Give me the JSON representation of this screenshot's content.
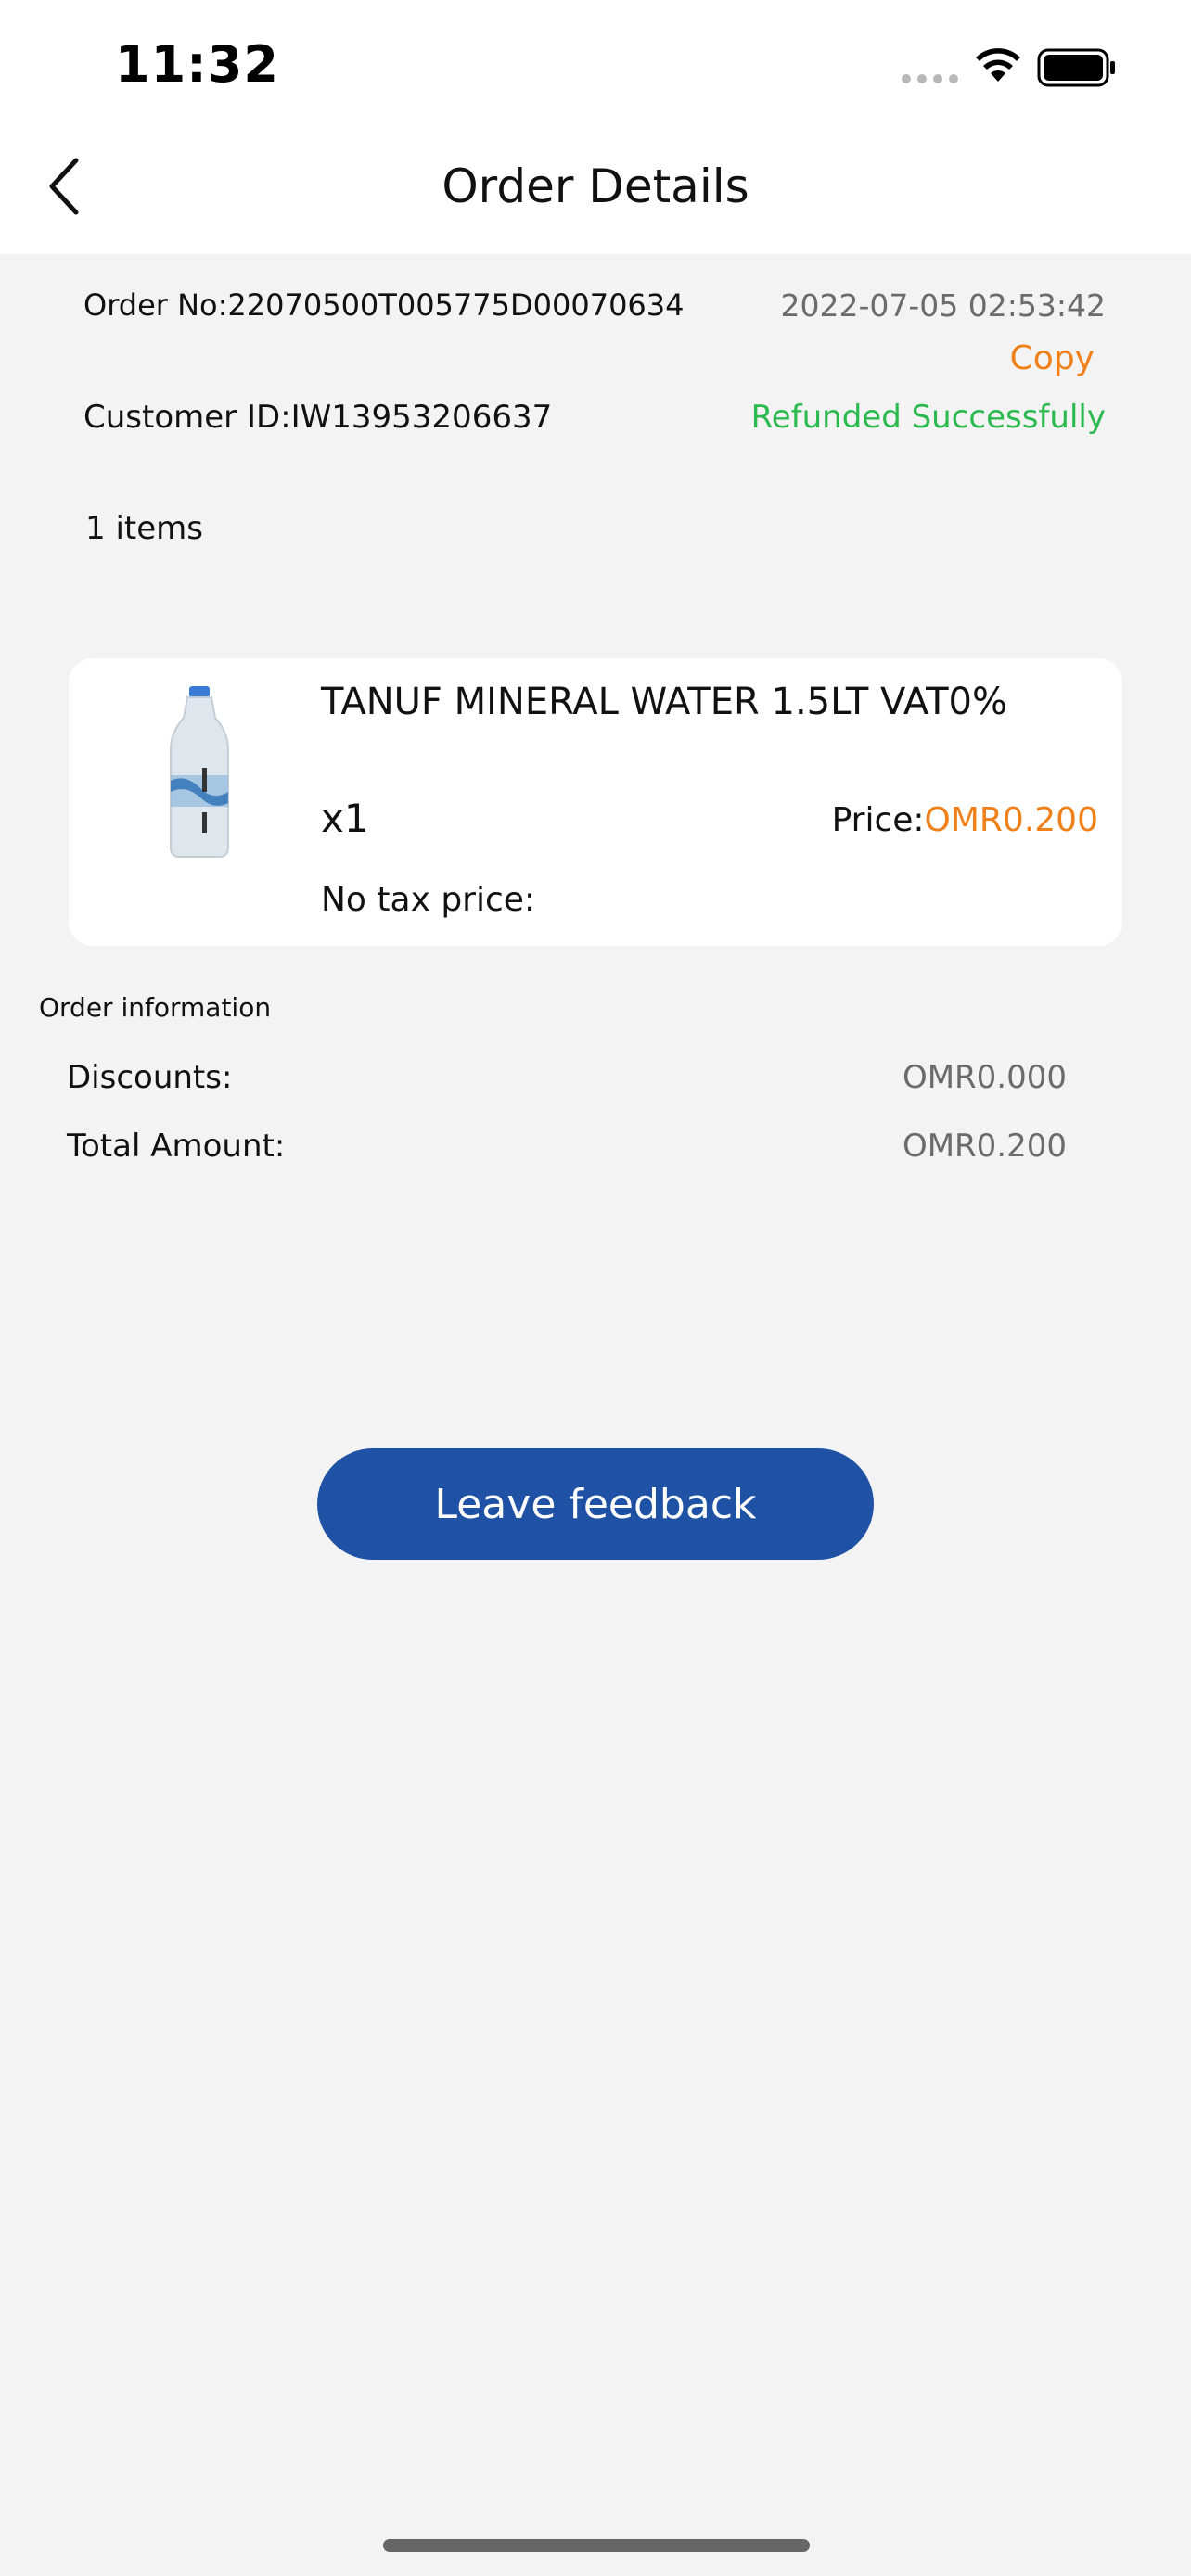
{
  "status_bar": {
    "time": "11:32"
  },
  "header": {
    "title": "Order Details",
    "back_icon": "chevron-left-icon"
  },
  "order": {
    "order_no": "Order No:22070500T005775D00070634",
    "datetime": "2022-07-05 02:53:42",
    "copy_label": "Copy",
    "customer_id": "Customer ID:IW13953206637",
    "status": "Refunded Successfully",
    "status_color": "#2cba50",
    "items_count": "1 items"
  },
  "product": {
    "name": "TANUF MINERAL WATER 1.5LT  VAT0%",
    "quantity": "x1",
    "price_label": "Price:",
    "price_value": "OMR0.200",
    "no_tax_label": "No tax price:",
    "image_icon": "water-bottle-icon"
  },
  "order_info": {
    "title": "Order information",
    "rows": [
      {
        "label": "Discounts:",
        "value": "OMR0.000"
      },
      {
        "label": "Total Amount:",
        "value": "OMR0.200"
      }
    ]
  },
  "actions": {
    "feedback_label": "Leave feedback"
  },
  "colors": {
    "accent_orange": "#f0801a",
    "primary_blue": "#1f52a5",
    "success_green": "#2cba50",
    "background": "#f3f3f3"
  }
}
